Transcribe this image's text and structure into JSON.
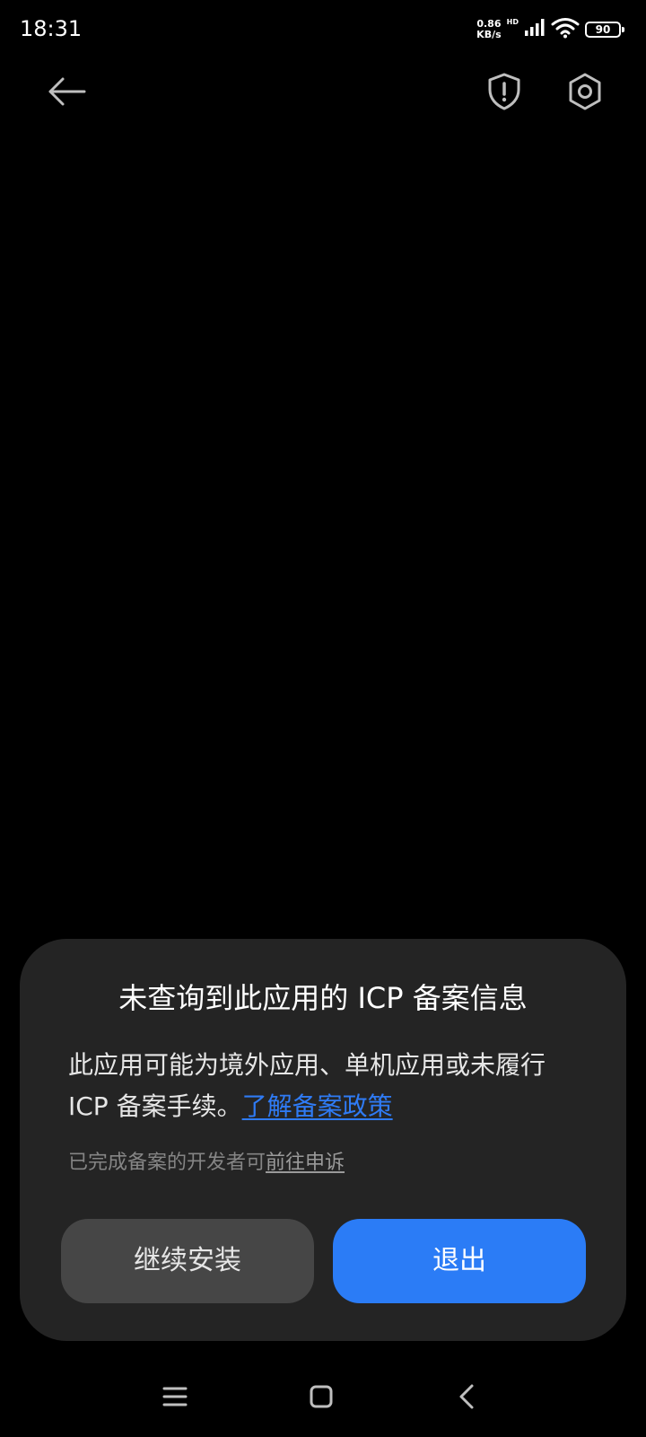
{
  "status_bar": {
    "time": "18:31",
    "net_speed_value": "0.86",
    "net_speed_unit": "KB/s",
    "network_tag": "HD",
    "battery": "90",
    "icons": [
      "signal-icon",
      "wifi-icon",
      "battery-icon"
    ]
  },
  "top_bar": {
    "icons": [
      "back-arrow-icon",
      "shield-alert-icon",
      "settings-hex-icon"
    ]
  },
  "dialog": {
    "title": "未查询到此应用的 ICP 备案信息",
    "message": "此应用可能为境外应用、单机应用或未履行 ICP 备案手续。",
    "policy_link": "了解备案政策",
    "note": "已完成备案的开发者可",
    "appeal_link": "前往申诉",
    "continue_label": "继续安装",
    "exit_label": "退出"
  },
  "nav_bar": {
    "icons": [
      "menu-icon",
      "home-icon",
      "back-icon"
    ]
  },
  "colors": {
    "background": "#000000",
    "dialog_background": "#242424",
    "primary_button": "#2b7cf6",
    "secondary_button": "#464646",
    "link": "#2f7bf5"
  }
}
